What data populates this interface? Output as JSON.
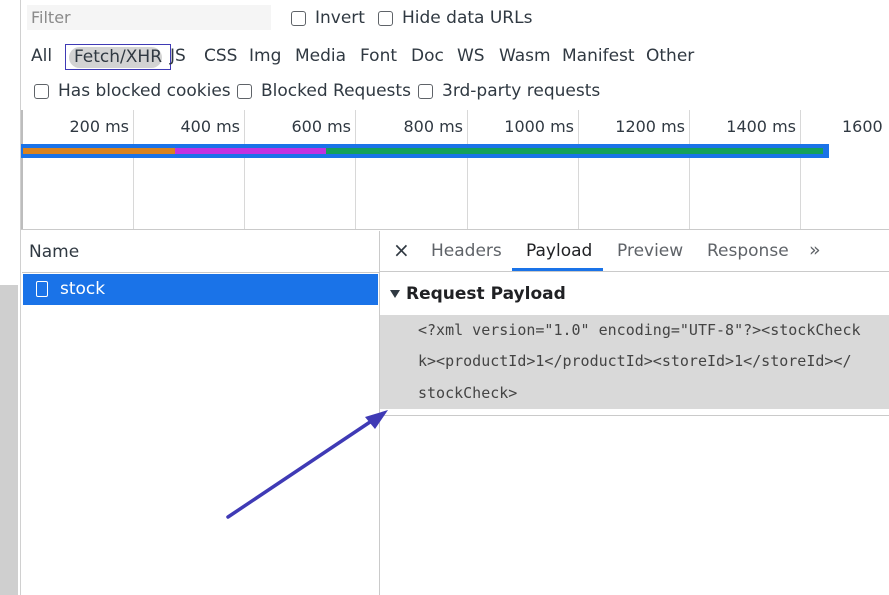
{
  "toolbar": {
    "filter_placeholder": "Filter",
    "filter_value": "",
    "invert_label": "Invert",
    "hide_data_urls_label": "Hide data URLs",
    "has_blocked_cookies_label": "Has blocked cookies",
    "blocked_requests_label": "Blocked Requests",
    "third_party_label": "3rd-party requests"
  },
  "type_filters": {
    "all": "All",
    "fetch_xhr": "Fetch/XHR",
    "js": "JS",
    "css": "CSS",
    "img": "Img",
    "media": "Media",
    "font": "Font",
    "doc": "Doc",
    "ws": "WS",
    "wasm": "Wasm",
    "manifest": "Manifest",
    "other": "Other",
    "selected": "Fetch/XHR"
  },
  "timeline": {
    "ticks": [
      "200 ms",
      "400 ms",
      "600 ms",
      "800 ms",
      "1000 ms",
      "1200 ms",
      "1400 ms",
      "1600 ms"
    ],
    "segment_colors": [
      "#d9831f",
      "#c132e0",
      "#14a05b"
    ],
    "bar_color": "#1a73e8"
  },
  "requests": {
    "header_name": "Name",
    "rows": [
      {
        "name": "stock",
        "selected": true
      }
    ]
  },
  "details": {
    "tabs": [
      "Headers",
      "Payload",
      "Preview",
      "Response"
    ],
    "active_tab": "Payload",
    "more_tabs": "»",
    "close": "×",
    "section_title": "Request Payload",
    "payload_lines": [
      "<?xml version=\"1.0\" encoding=\"UTF-8\"?><stockCheck",
      "k><productId>1</productId><storeId>1</storeId></",
      "stockCheck>"
    ]
  },
  "colors": {
    "accent": "#1a73e8",
    "annotation": "#3f3ab5",
    "payload_bg": "#d9d9d9"
  }
}
